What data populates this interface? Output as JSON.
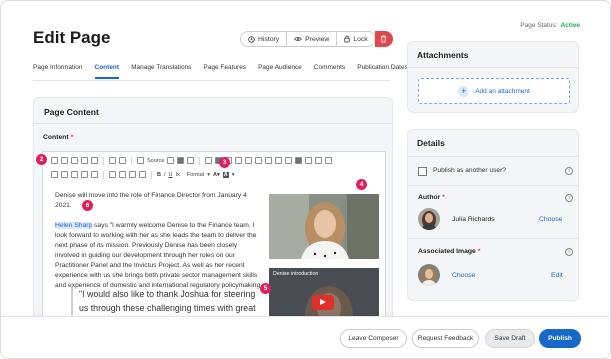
{
  "page_status": {
    "label": "Page Status:",
    "value": "Active"
  },
  "title": "Edit Page",
  "actions": {
    "history": "History",
    "preview": "Preview",
    "lock": "Lock"
  },
  "tabs": [
    "Page Information",
    "Content",
    "Manage Translations",
    "Page Features",
    "Page Audience",
    "Comments",
    "Publication Dates"
  ],
  "content_card": {
    "title": "Page Content",
    "field_label": "Content",
    "required": "*"
  },
  "toolbar": {
    "source": "Source",
    "format": "Format"
  },
  "editor": {
    "line1": "Denise will move into the role of Finance Director from January 4 2021.",
    "link_name": "Helen Sharp",
    "paragraph": " says \"I warmly welcome Denise to the Finance team. I look forward to working with her as she leads the team to deliver the next phase of its mission. Previously Denise has been closely involved in guiding our development through her roles on our Practitioner Panel and the Invictus Project. As well as her recent experience with us she brings both private sector management skills and experience of domestic and international regulatory policymaking.",
    "quote": "\"I would also like to thank Joshua for steering us through these challenging times with great",
    "video_title": "Denise introduction"
  },
  "markers": [
    "2",
    "3",
    "4",
    "5",
    "6"
  ],
  "attachments": {
    "title": "Attachments",
    "add": "Add an attachment"
  },
  "details": {
    "title": "Details",
    "publish_other": "Publish as another user?",
    "author_label": "Author",
    "author_name": "Julia Richards",
    "author_choose": "Choose",
    "image_label": "Associated Image",
    "image_choose": "Choose",
    "image_edit": "Edit"
  },
  "footer": {
    "leave": "Leave Composer",
    "feedback": "Request Feedback",
    "draft": "Save Draft",
    "publish": "Publish"
  },
  "colors": {
    "accent": "#1769c9",
    "danger": "#e2464e",
    "marker": "#e0205c",
    "active": "#1fa85a"
  }
}
